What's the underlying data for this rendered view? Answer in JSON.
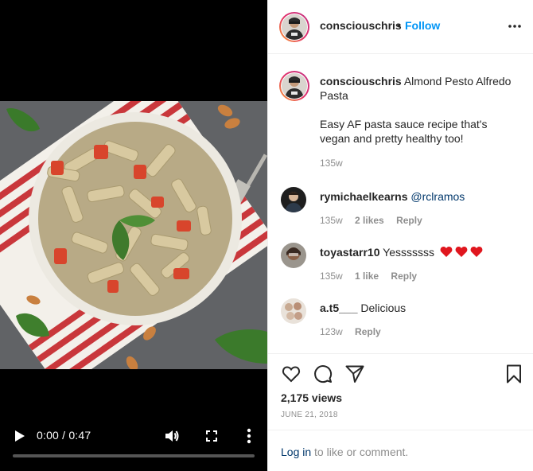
{
  "video": {
    "time": "0:00 / 0:47",
    "progress": 0
  },
  "header": {
    "username": "consciouschris",
    "separator": "•",
    "follow_label": "Follow"
  },
  "caption": {
    "username": "consciouschris",
    "title": "Almond Pesto Alfredo Pasta",
    "body": "Easy AF pasta sauce recipe that's vegan and pretty healthy too!",
    "time": "135w"
  },
  "comments": [
    {
      "username": "rymichaelkearns",
      "text": "@rclramos",
      "time": "135w",
      "likes": "2 likes",
      "reply": "Reply"
    },
    {
      "username": "toyastarr10",
      "text": "Yesssssss",
      "emoji": "red-heart x3",
      "time": "135w",
      "likes": "1 like",
      "reply": "Reply"
    },
    {
      "username": "a.t5___",
      "text": "Delicious",
      "time": "123w",
      "reply": "Reply"
    }
  ],
  "stats": {
    "views": "2,175 views",
    "date": "JUNE 21, 2018"
  },
  "login": {
    "link": "Log in",
    "rest": " to like or comment."
  },
  "colors": {
    "accent": "#0095f6",
    "link": "#00376b",
    "muted": "#8e8e8e",
    "heart": "#ed4956"
  },
  "icons": [
    "play-icon",
    "volume-icon",
    "fullscreen-icon",
    "more-vertical-icon",
    "more-horizontal-icon",
    "heart-icon",
    "comment-icon",
    "share-icon",
    "bookmark-icon"
  ]
}
